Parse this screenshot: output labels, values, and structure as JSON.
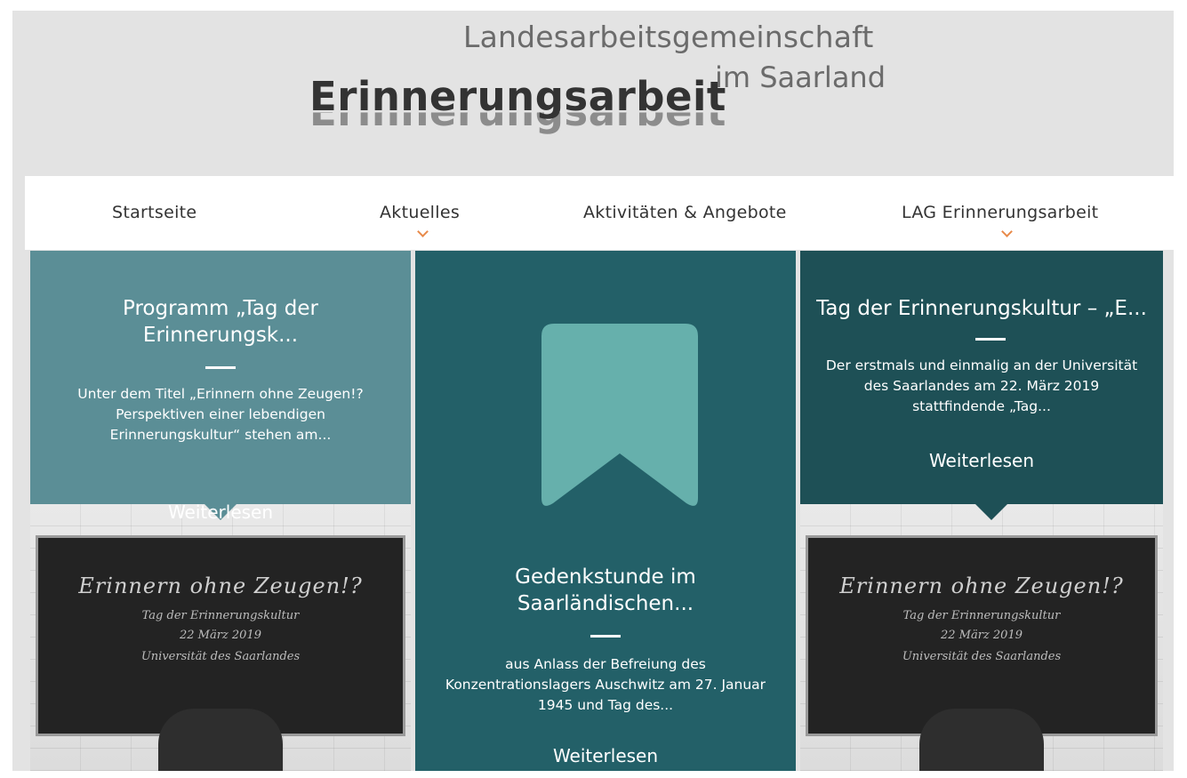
{
  "logo": {
    "top_line": "Landesarbeitsgemeinschaft",
    "main_word": "Erinnerungsarbeit",
    "sub_line": "im Saarland"
  },
  "nav": {
    "items": [
      {
        "label": "Startseite",
        "has_dropdown": false
      },
      {
        "label": "Aktuelles",
        "has_dropdown": true
      },
      {
        "label": "Aktivitäten & Angebote",
        "has_dropdown": false
      },
      {
        "label": "LAG Erinnerungsarbeit",
        "has_dropdown": true
      }
    ]
  },
  "cards": [
    {
      "title": "Programm „Tag der Erinnerungsk...",
      "text": "Unter dem Titel „Erinnern  ohne Zeugen!? Perspektiven einer lebendigen Erinnerungskultur“ stehen am...",
      "link": "Weiterlesen"
    },
    {
      "title": "Gedenkstunde im Saarländischen...",
      "text": "aus Anlass der Befreiung des Konzentrationslagers Auschwitz am 27. Januar 1945 und Tag des...",
      "link": "Weiterlesen"
    },
    {
      "title": "Tag der Erinnerungskultur – „E...",
      "text": "Der erstmals und einmalig an der Universität des Saarlandes am 22. März 2019 stattfindende „Tag...",
      "link": "Weiterlesen"
    }
  ],
  "chalkboard": {
    "line1": "Erinnern ohne Zeugen!?",
    "line2": "Tag der Erinnerungskultur",
    "line3": "22 März 2019",
    "line4": "Universität des Saarlandes"
  },
  "colors": {
    "background": "#e3e3e3",
    "card1": "#5b8e96",
    "card2": "#236068",
    "card3": "#1e5056",
    "bookmark": "#66b0ac",
    "accent": "#e88a4a"
  }
}
